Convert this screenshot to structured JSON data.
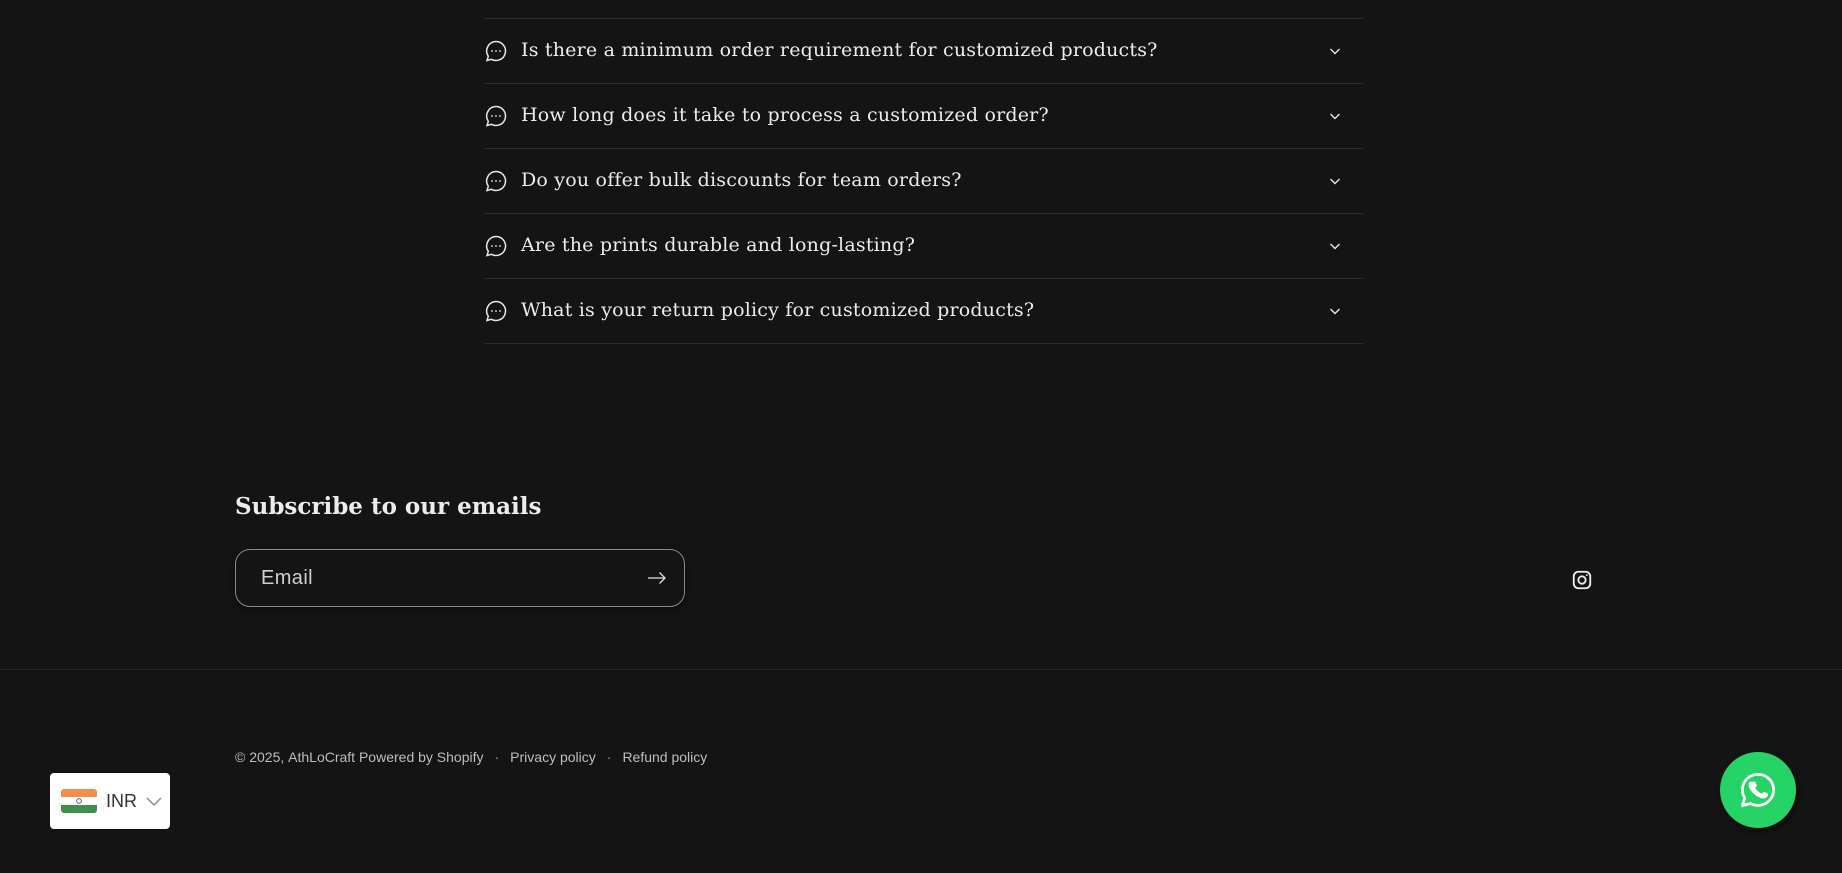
{
  "faq": {
    "items": [
      {
        "question": "Is there a minimum order requirement for customized products?",
        "icon": "chat-bubble-icon",
        "toggle_icon": "chevron-down-icon"
      },
      {
        "question": "How long does it take to process a customized order?",
        "icon": "chat-bubble-icon",
        "toggle_icon": "chevron-down-icon"
      },
      {
        "question": "Do you offer bulk discounts for team orders?",
        "icon": "chat-bubble-icon",
        "toggle_icon": "chevron-down-icon"
      },
      {
        "question": "Are the prints durable and long-lasting?",
        "icon": "chat-bubble-icon",
        "toggle_icon": "chevron-down-icon"
      },
      {
        "question": "What is your return policy for customized products?",
        "icon": "chat-bubble-icon",
        "toggle_icon": "chevron-down-icon"
      }
    ]
  },
  "newsletter": {
    "heading": "Subscribe to our emails",
    "email_placeholder": "Email",
    "email_value": "",
    "submit_icon": "arrow-right-icon"
  },
  "social": {
    "instagram_icon": "instagram-icon"
  },
  "footer": {
    "copyright_prefix": "© 2025,",
    "brand": "AthLoCraft",
    "powered_by": "Powered by Shopify",
    "separator": "·",
    "links": [
      {
        "label": "Privacy policy"
      },
      {
        "label": "Refund policy"
      }
    ]
  },
  "currency": {
    "code": "INR",
    "flag_icon": "india-flag-icon",
    "chevron_icon": "chevron-down-icon"
  },
  "whatsapp": {
    "icon": "whatsapp-icon",
    "color": "#25d366"
  },
  "colors": {
    "background": "#141414",
    "text": "#ececec",
    "divider": "#2b2b2b",
    "whatsapp": "#25d366"
  }
}
